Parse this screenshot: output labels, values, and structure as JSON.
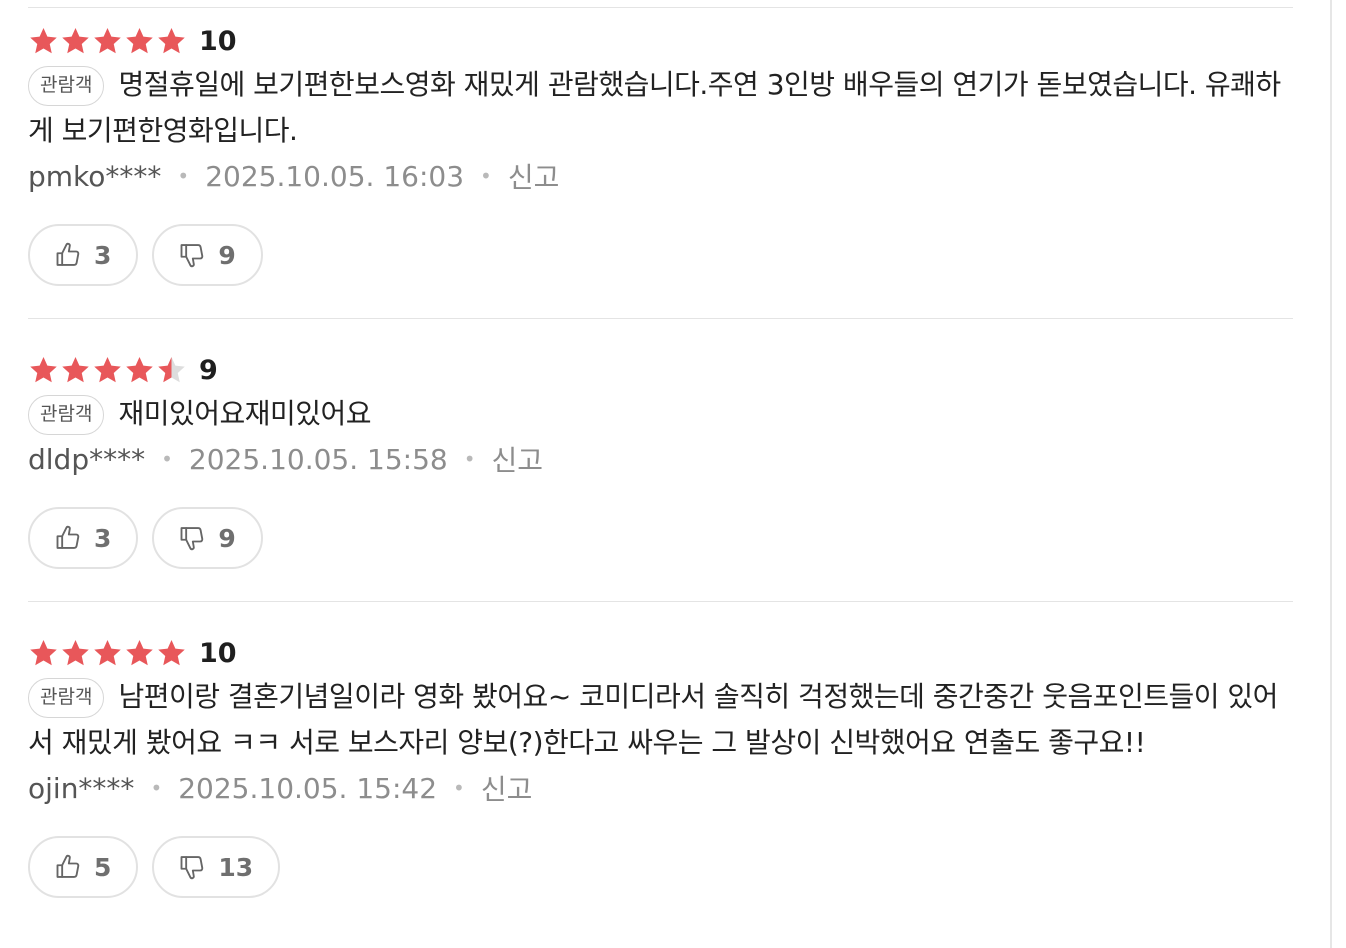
{
  "colors": {
    "star_filled": "#e8575a",
    "star_empty": "#dddddd",
    "text_primary": "#222222",
    "text_muted": "#8d8d8d",
    "border": "#e2e2e2"
  },
  "icons": {
    "star": "star-icon",
    "like": "thumbs-up-icon",
    "dislike": "thumbs-down-icon"
  },
  "reviews": [
    {
      "stars": 5,
      "score": "10",
      "badge": "관람객",
      "text": "명절휴일에 보기편한보스영화 재밌게 관람했습니다.주연 3인방 배우들의 연기가 돋보였습니다. 유쾌하게 보기편한영화입니다.",
      "author": "pmko****",
      "datetime": "2025.10.05. 16:03",
      "report_label": "신고",
      "likes": "3",
      "dislikes": "9"
    },
    {
      "stars": 4.5,
      "score": "9",
      "badge": "관람객",
      "text": "재미있어요재미있어요",
      "author": "dldp****",
      "datetime": "2025.10.05. 15:58",
      "report_label": "신고",
      "likes": "3",
      "dislikes": "9"
    },
    {
      "stars": 5,
      "score": "10",
      "badge": "관람객",
      "text": "남편이랑 결혼기념일이라 영화 봤어요~ 코미디라서 솔직히 걱정했는데 중간중간 웃음포인트들이 있어서 재밌게 봤어요 ㅋㅋ 서로 보스자리 양보(?)한다고 싸우는 그 발상이 신박했어요 연출도 좋구요!!",
      "author": "ojin****",
      "datetime": "2025.10.05. 15:42",
      "report_label": "신고",
      "likes": "5",
      "dislikes": "13"
    }
  ]
}
